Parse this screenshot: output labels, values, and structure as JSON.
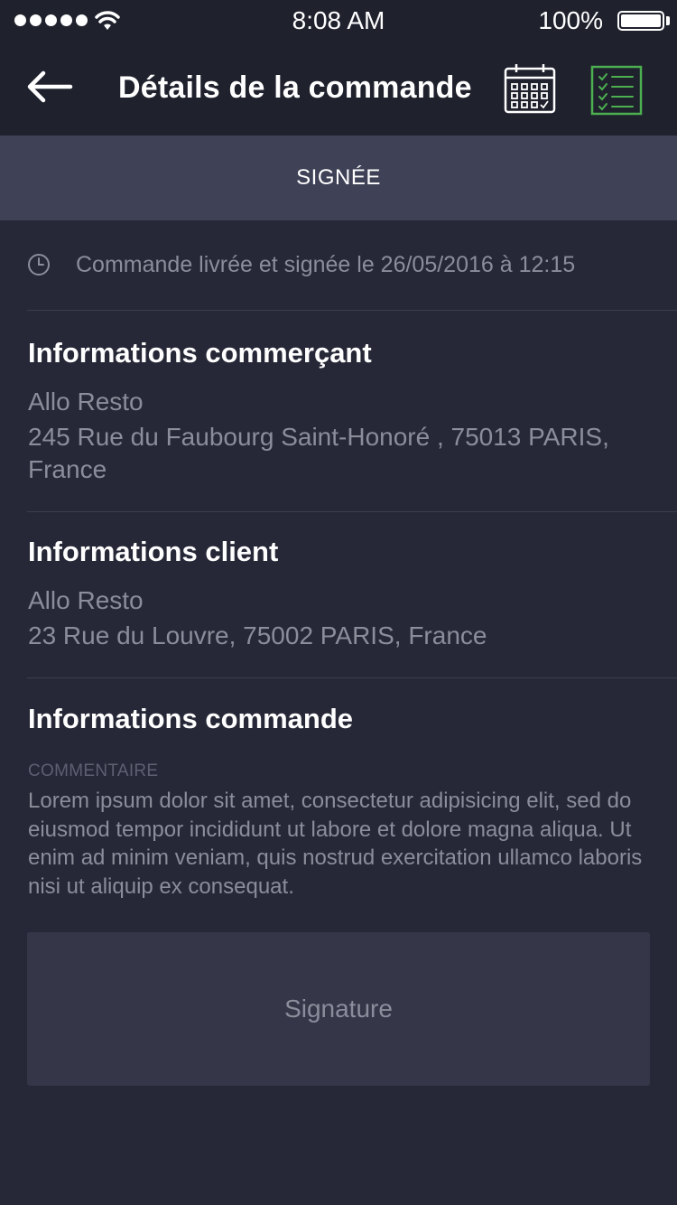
{
  "status_bar": {
    "time": "8:08 AM",
    "battery_pct": "100%",
    "battery_level": 1.0
  },
  "nav": {
    "title": "Détails de la commande",
    "back_icon": "arrow-left-icon",
    "calendar_icon": "calendar-icon",
    "checklist_icon": "checklist-icon",
    "checklist_color": "#4caf50"
  },
  "order": {
    "status": "SIGNÉE",
    "delivery_info": "Commande livrée et signée le 26/05/2016 à 12:15"
  },
  "merchant": {
    "heading": "Informations commerçant",
    "name": "Allo Resto",
    "address": "245 Rue du Faubourg Saint-Honoré , 75013 PARIS, France"
  },
  "client": {
    "heading": "Informations client",
    "name": "Allo Resto",
    "address": "23 Rue du Louvre, 75002 PARIS, France"
  },
  "order_info": {
    "heading": "Informations commande",
    "comment_label": "COMMENTAIRE",
    "comment": "Lorem ipsum dolor sit amet, consectetur adipisicing elit, sed do eiusmod tempor incididunt ut labore et dolore magna aliqua. Ut enim ad minim veniam, quis nostrud exercitation ullamco laboris nisi ut aliquip ex consequat.",
    "signature_placeholder": "Signature"
  },
  "colors": {
    "background": "#262837",
    "header": "#1f212d",
    "banner": "#3f4156",
    "muted_text": "#8b8d9b",
    "signature_box": "#353749"
  }
}
